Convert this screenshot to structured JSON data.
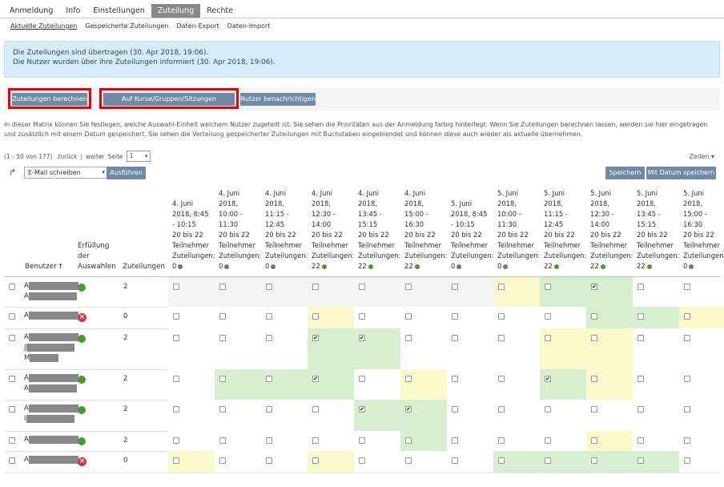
{
  "tabs": [
    "Anmeldung",
    "Info",
    "Einstellungen",
    "Zuteilung",
    "Rechte"
  ],
  "active_tab": "Zuteilung",
  "subnav": [
    "Aktuelle Zuteilungen",
    "Gespeicherte Zuteilungen",
    "Daten-Export",
    "Daten-Import"
  ],
  "info": {
    "line1": "Die Zuteilungen sind übertragen (30. Apr 2018, 19:06).",
    "line2": "Die Nutzer wurden über ihre Zuteilungen informiert (30. Apr 2018, 19:06)."
  },
  "buttons": {
    "berechnen": "Zuteilungen berechnen",
    "uebertragen": "Auf Kurse/Gruppen/Sitzungen übertragen",
    "benachrichtigen": "Nutzer benachrichtigen",
    "ausfuehren": "Ausführen",
    "speichern": "Speichern",
    "mit_datum": "Mit Datum speichern"
  },
  "colors": {
    "button": "#6d8aa6",
    "highlight_red": "#e00000",
    "info_bg": "#d4edf8",
    "green_cell": "#d6f0cf",
    "yellow_cell": "#fbf8c9",
    "grey_cell": "#f4f4f4"
  },
  "description": "In dieser Matrix können Sie festlegen, welche Auswahl-Einheit welchem Nutzer zugeteilt ist. Sie sehen die Prioritäten aus der Anmeldung farbig hinterlegt. Wenn Sie Zuteilungen berechnen lassen, werden sie hier eingetragen und zusätzlich mit einem Datum gespeichert. Sie sehen die Verteilung gespeicherter Zuteilungen mit Buchstaben eingeblendet und können diese auch wieder als aktuelle übernehmen.",
  "pager": {
    "range": "(1 - 50 von 177)",
    "back": "zurück",
    "sep": "|",
    "next": "weiter",
    "page_label": "Seite",
    "page": "1"
  },
  "zeilen": "Zeilen ▾",
  "action_select": "E-Mail schreiben",
  "columns": {
    "benutzer": "Benutzer",
    "erfuellung": "Erfüllung der Auswahlen",
    "zuteilungen": "Zuteilungen"
  },
  "dates": [
    {
      "lines": [
        "4. Juni",
        "2018, 8:45",
        "- 10:15",
        "20 bis 22",
        "Teilnehmer",
        "Zuteilungen:",
        "0"
      ],
      "dot": "grey"
    },
    {
      "lines": [
        "4. Juni",
        "2018,",
        "10:00 -",
        "11:30",
        "20 bis 22",
        "Teilnehmer",
        "Zuteilungen:",
        "0"
      ],
      "dot": "grey"
    },
    {
      "lines": [
        "4. Juni",
        "2018,",
        "11:15 -",
        "12:45",
        "20 bis 22",
        "Teilnehmer",
        "Zuteilungen:",
        "0"
      ],
      "dot": "grey"
    },
    {
      "lines": [
        "4. Juni",
        "2018,",
        "12:30 -",
        "14:00",
        "20 bis 22",
        "Teilnehmer",
        "Zuteilungen:",
        "22"
      ],
      "dot": "green"
    },
    {
      "lines": [
        "4. Juni",
        "2018,",
        "13:45 -",
        "15:15",
        "20 bis 22",
        "Teilnehmer",
        "Zuteilungen:",
        "22"
      ],
      "dot": "green"
    },
    {
      "lines": [
        "4. Juni",
        "2018,",
        "15:00 -",
        "16:30",
        "20 bis 22",
        "Teilnehmer",
        "Zuteilungen:",
        "22"
      ],
      "dot": "green"
    },
    {
      "lines": [
        "5. Juni",
        "2018, 8:45",
        "- 10:15",
        "20 bis 22",
        "Teilnehmer",
        "Zuteilungen:",
        "0"
      ],
      "dot": "grey"
    },
    {
      "lines": [
        "5. Juni",
        "2018,",
        "10:00 -",
        "11:30",
        "20 bis 22",
        "Teilnehmer",
        "Zuteilungen:",
        "0"
      ],
      "dot": "grey"
    },
    {
      "lines": [
        "5. Juni",
        "2018,",
        "11:15 -",
        "12:45",
        "20 bis 22",
        "Teilnehmer",
        "Zuteilungen:",
        "22"
      ],
      "dot": "green"
    },
    {
      "lines": [
        "5. Juni",
        "2018,",
        "12:30 -",
        "14:00",
        "20 bis 22",
        "Teilnehmer",
        "Zuteilungen:",
        "22"
      ],
      "dot": "green"
    },
    {
      "lines": [
        "5. Juni",
        "2018,",
        "13:45 -",
        "15:15",
        "20 bis 22",
        "Teilnehmer",
        "Zuteilungen:",
        "22"
      ],
      "dot": "green"
    },
    {
      "lines": [
        "5. Juni",
        "2018,",
        "15:00 -",
        "16:30",
        "20 bis 22",
        "Teilnehmer",
        "Zuteilungen:",
        "0"
      ],
      "dot": "grey"
    }
  ],
  "rows": [
    {
      "initial": "A",
      "second": "A",
      "third": "",
      "status": "ok",
      "count": "2",
      "cells": [
        "g",
        "g",
        "g",
        "g",
        "g",
        "g",
        "g",
        "y",
        "G",
        "G",
        "w",
        "w"
      ],
      "checked": [
        false,
        false,
        false,
        false,
        false,
        false,
        false,
        false,
        false,
        true,
        false,
        false
      ]
    },
    {
      "initial": "A",
      "second": "",
      "third": "",
      "status": "x",
      "count": "0",
      "cells": [
        "w",
        "w",
        "w",
        "y",
        "w",
        "w",
        "w",
        "w",
        "w",
        "G",
        "G",
        "y"
      ],
      "checked": [
        false,
        false,
        false,
        false,
        false,
        false,
        false,
        false,
        false,
        false,
        false,
        false
      ]
    },
    {
      "initial": "A",
      "second": "J",
      "third": "M",
      "status": "ok",
      "count": "2",
      "cells": [
        "w",
        "w",
        "w",
        "G",
        "G",
        "w",
        "w",
        "w",
        "y",
        "y",
        "w",
        "w"
      ],
      "checked": [
        false,
        false,
        false,
        true,
        true,
        false,
        false,
        false,
        false,
        false,
        false,
        false
      ]
    },
    {
      "initial": "A",
      "second": "A",
      "third": "",
      "status": "ok",
      "count": "2",
      "cells": [
        "w",
        "G",
        "G",
        "G",
        "w",
        "y",
        "w",
        "w",
        "G",
        "y",
        "w",
        "w"
      ],
      "checked": [
        false,
        false,
        false,
        true,
        false,
        false,
        false,
        false,
        true,
        false,
        false,
        false
      ]
    },
    {
      "initial": "A",
      "second": "I",
      "third": "",
      "status": "ok",
      "count": "2",
      "cells": [
        "w",
        "w",
        "w",
        "w",
        "G",
        "G",
        "w",
        "w",
        "w",
        "w",
        "w",
        "w"
      ],
      "checked": [
        false,
        false,
        false,
        false,
        true,
        true,
        false,
        false,
        false,
        false,
        false,
        false
      ]
    },
    {
      "initial": "A",
      "second": "",
      "third": "",
      "status": "ok",
      "count": "2",
      "cells": [
        "w",
        "w",
        "w",
        "w",
        "w",
        "G",
        "w",
        "w",
        "w",
        "y",
        "w",
        "w"
      ],
      "checked": [
        false,
        false,
        false,
        false,
        false,
        false,
        false,
        false,
        false,
        false,
        false,
        false
      ]
    },
    {
      "initial": "A",
      "second": "",
      "third": "",
      "status": "x",
      "count": "0",
      "cells": [
        "y",
        "w",
        "w",
        "y",
        "w",
        "w",
        "w",
        "G",
        "G",
        "G",
        "G",
        "w"
      ],
      "checked": [
        false,
        false,
        false,
        false,
        false,
        false,
        false,
        false,
        false,
        false,
        false,
        false
      ]
    }
  ]
}
